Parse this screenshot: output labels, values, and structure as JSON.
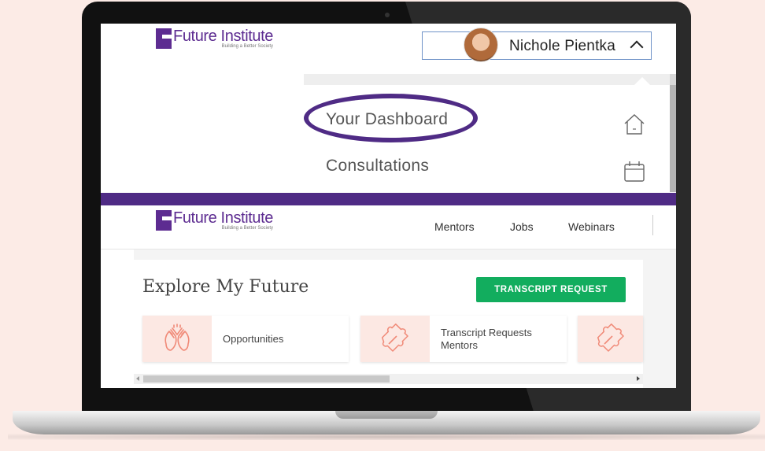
{
  "brand": {
    "name": "Future Institute",
    "tagline": "Building a Better Society"
  },
  "user": {
    "name": "Nichole Pientka"
  },
  "dropdown": {
    "items": [
      {
        "label": "Your Dashboard",
        "icon": "home-icon"
      },
      {
        "label": "Consultations",
        "icon": "calendar-icon"
      }
    ]
  },
  "nav": {
    "links": [
      "Mentors",
      "Jobs",
      "Webinars"
    ]
  },
  "main": {
    "section_title": "Explore My Future",
    "transcript_button": "TRANSCRIPT REQUEST",
    "tiles": [
      {
        "label": "Opportunities",
        "icon": "clapping-hands-icon"
      },
      {
        "label_line1": "Transcript Requests",
        "label_line2": "Mentors",
        "icon": "puzzle-icon"
      },
      {
        "icon": "puzzle-icon"
      }
    ]
  },
  "colors": {
    "brand_purple": "#5d2c91",
    "highlight_purple": "#4f2b85",
    "button_green": "#12ad5e",
    "tile_icon_bg": "#fce8e3",
    "icon_coral": "#f08a78"
  }
}
